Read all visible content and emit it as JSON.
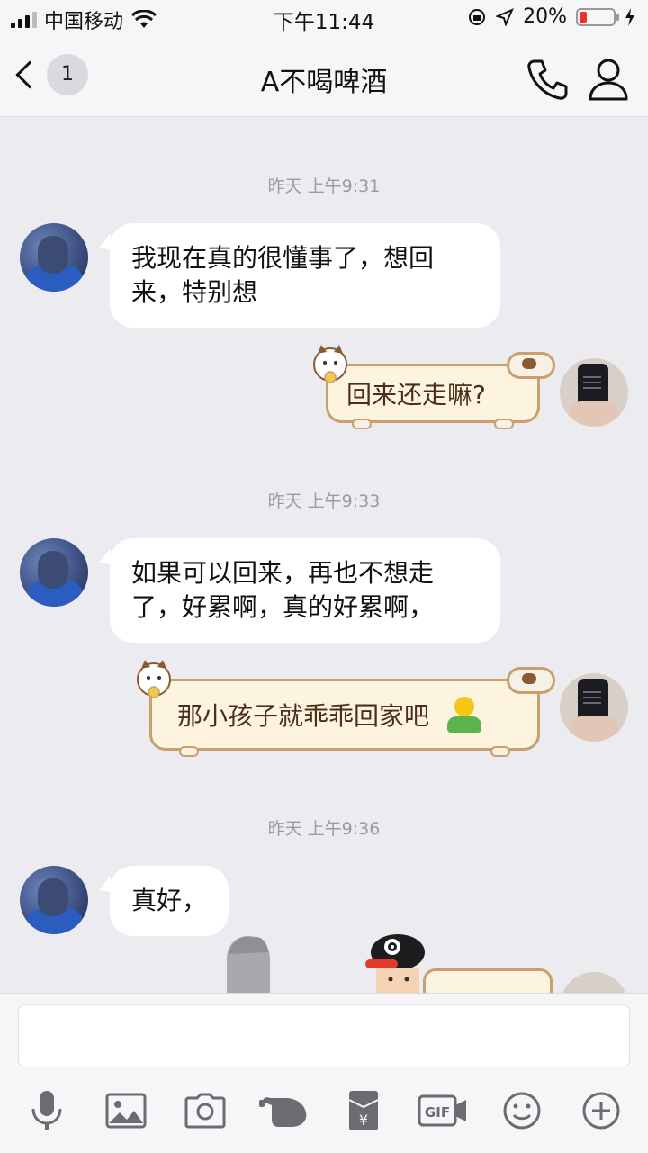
{
  "status_bar": {
    "carrier": "中国移动",
    "time": "下午11:44",
    "battery": "20%",
    "battery_level": 0.2,
    "icons": [
      "signal-icon",
      "wifi-icon",
      "rotation-lock-icon",
      "location-icon",
      "battery-icon",
      "charging-icon"
    ]
  },
  "nav": {
    "unread_count": "1",
    "title": "A不喝啤酒",
    "icons": [
      "back-chevron-icon",
      "phone-icon",
      "profile-icon"
    ]
  },
  "messages": [
    {
      "type": "timestamp",
      "text": "昨天 上午9:31"
    },
    {
      "type": "incoming",
      "line1": "我现在真的很懂事了，想回",
      "line2": "来，特别想"
    },
    {
      "type": "outgoing",
      "text": "回来还走嘛?"
    },
    {
      "type": "timestamp",
      "text": "昨天 上午9:33"
    },
    {
      "type": "incoming",
      "line1": "如果可以回来，再也不想走",
      "line2": "了，好累啊，真的好累啊，"
    },
    {
      "type": "outgoing",
      "text": "那小孩子就乖乖回家吧",
      "emoji": "person-emoji"
    },
    {
      "type": "timestamp",
      "text": "昨天 上午9:36"
    },
    {
      "type": "incoming",
      "line1": "真好，"
    }
  ],
  "input": {
    "placeholder": "",
    "value": ""
  },
  "toolbar": {
    "items": [
      "microphone-icon",
      "image-icon",
      "camera-icon",
      "poke-icon",
      "red-packet-icon",
      "gif-icon",
      "emoji-icon",
      "plus-icon"
    ],
    "gif_label": "GIF",
    "yuan_label": "¥"
  },
  "colors": {
    "background": "#ebebf0",
    "bubble_incoming": "#ffffff",
    "bubble_outgoing": "#fdf4e0",
    "bubble_outgoing_border": "#c8a070",
    "battery_low": "#e5332a"
  }
}
